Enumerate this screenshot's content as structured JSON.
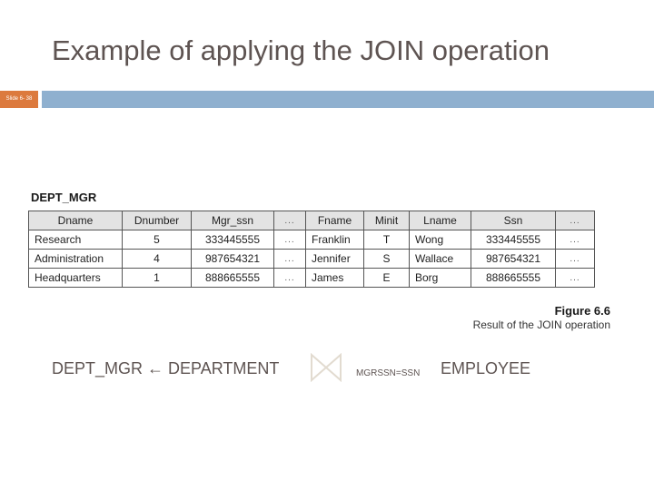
{
  "slide": {
    "title": "Example of applying the JOIN operation",
    "slide_number": "Slide 6- 38"
  },
  "figure": {
    "table_name": "DEPT_MGR",
    "columns": [
      "Dname",
      "Dnumber",
      "Mgr_ssn",
      "...",
      "Fname",
      "Minit",
      "Lname",
      "Ssn",
      "..."
    ],
    "rows": [
      [
        "Research",
        "5",
        "333445555",
        "...",
        "Franklin",
        "T",
        "Wong",
        "333445555",
        "..."
      ],
      [
        "Administration",
        "4",
        "987654321",
        "...",
        "Jennifer",
        "S",
        "Wallace",
        "987654321",
        "..."
      ],
      [
        "Headquarters",
        "1",
        "888665555",
        "...",
        "James",
        "E",
        "Borg",
        "888665555",
        "..."
      ]
    ],
    "figure_number": "Figure 6.6",
    "caption": "Result of the JOIN operation"
  },
  "expression": {
    "result": "DEPT_MGR",
    "assign_symbol": "←",
    "left_relation": "DEPARTMENT",
    "operator_icon": "join-bowtie-icon",
    "condition": "MGRSSN=SSN",
    "right_relation": "EMPLOYEE"
  }
}
